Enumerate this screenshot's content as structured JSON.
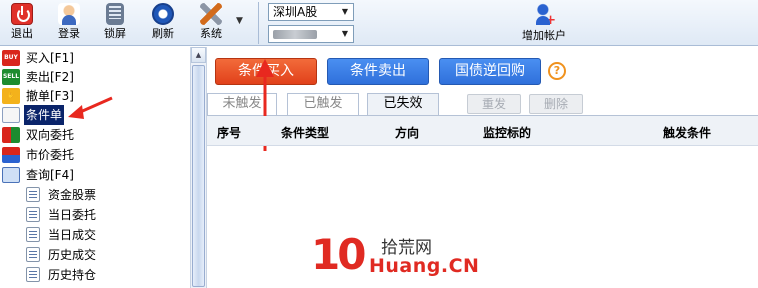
{
  "toolbar": {
    "buttons": [
      {
        "label": "退出",
        "icon": "power-icon"
      },
      {
        "label": "登录",
        "icon": "user-icon"
      },
      {
        "label": "锁屏",
        "icon": "lock-icon"
      },
      {
        "label": "刷新",
        "icon": "refresh-icon"
      },
      {
        "label": "系统",
        "icon": "tools-icon"
      }
    ],
    "market_select": "深圳A股",
    "account_select_value": "",
    "add_account_label": "增加帐户"
  },
  "sidebar": {
    "items": [
      {
        "label": "买入[F1]",
        "badge": "BUY"
      },
      {
        "label": "卖出[F2]",
        "badge": "SELL"
      },
      {
        "label": "撤单[F3]",
        "badge": ""
      },
      {
        "label": "条件单",
        "badge": ""
      },
      {
        "label": "双向委托",
        "badge": ""
      },
      {
        "label": "市价委托",
        "badge": ""
      },
      {
        "label": "查询[F4]",
        "badge": ""
      }
    ],
    "subitems": [
      {
        "label": "资金股票"
      },
      {
        "label": "当日委托"
      },
      {
        "label": "当日成交"
      },
      {
        "label": "历史成交"
      },
      {
        "label": "历史持仓"
      }
    ],
    "selected": "条件单"
  },
  "main": {
    "buttons": {
      "buy": "条件买入",
      "sell": "条件卖出",
      "repo": "国债逆回购"
    },
    "help": "?",
    "tabs": [
      {
        "label": "未触发"
      },
      {
        "label": "已触发"
      },
      {
        "label": "已失效",
        "active": true
      }
    ],
    "actions": {
      "reissue": "重发",
      "delete": "删除"
    },
    "columns": [
      "序号",
      "条件类型",
      "方向",
      "监控标的",
      "触发条件"
    ]
  },
  "watermark": {
    "logo": "10",
    "cn": "拾荒网",
    "en": "Huang.CN"
  },
  "colors": {
    "buy_button": "#e1411b",
    "blue_button": "#2f70db",
    "selection": "#0a246a",
    "annotation_arrow": "#e8281f"
  }
}
